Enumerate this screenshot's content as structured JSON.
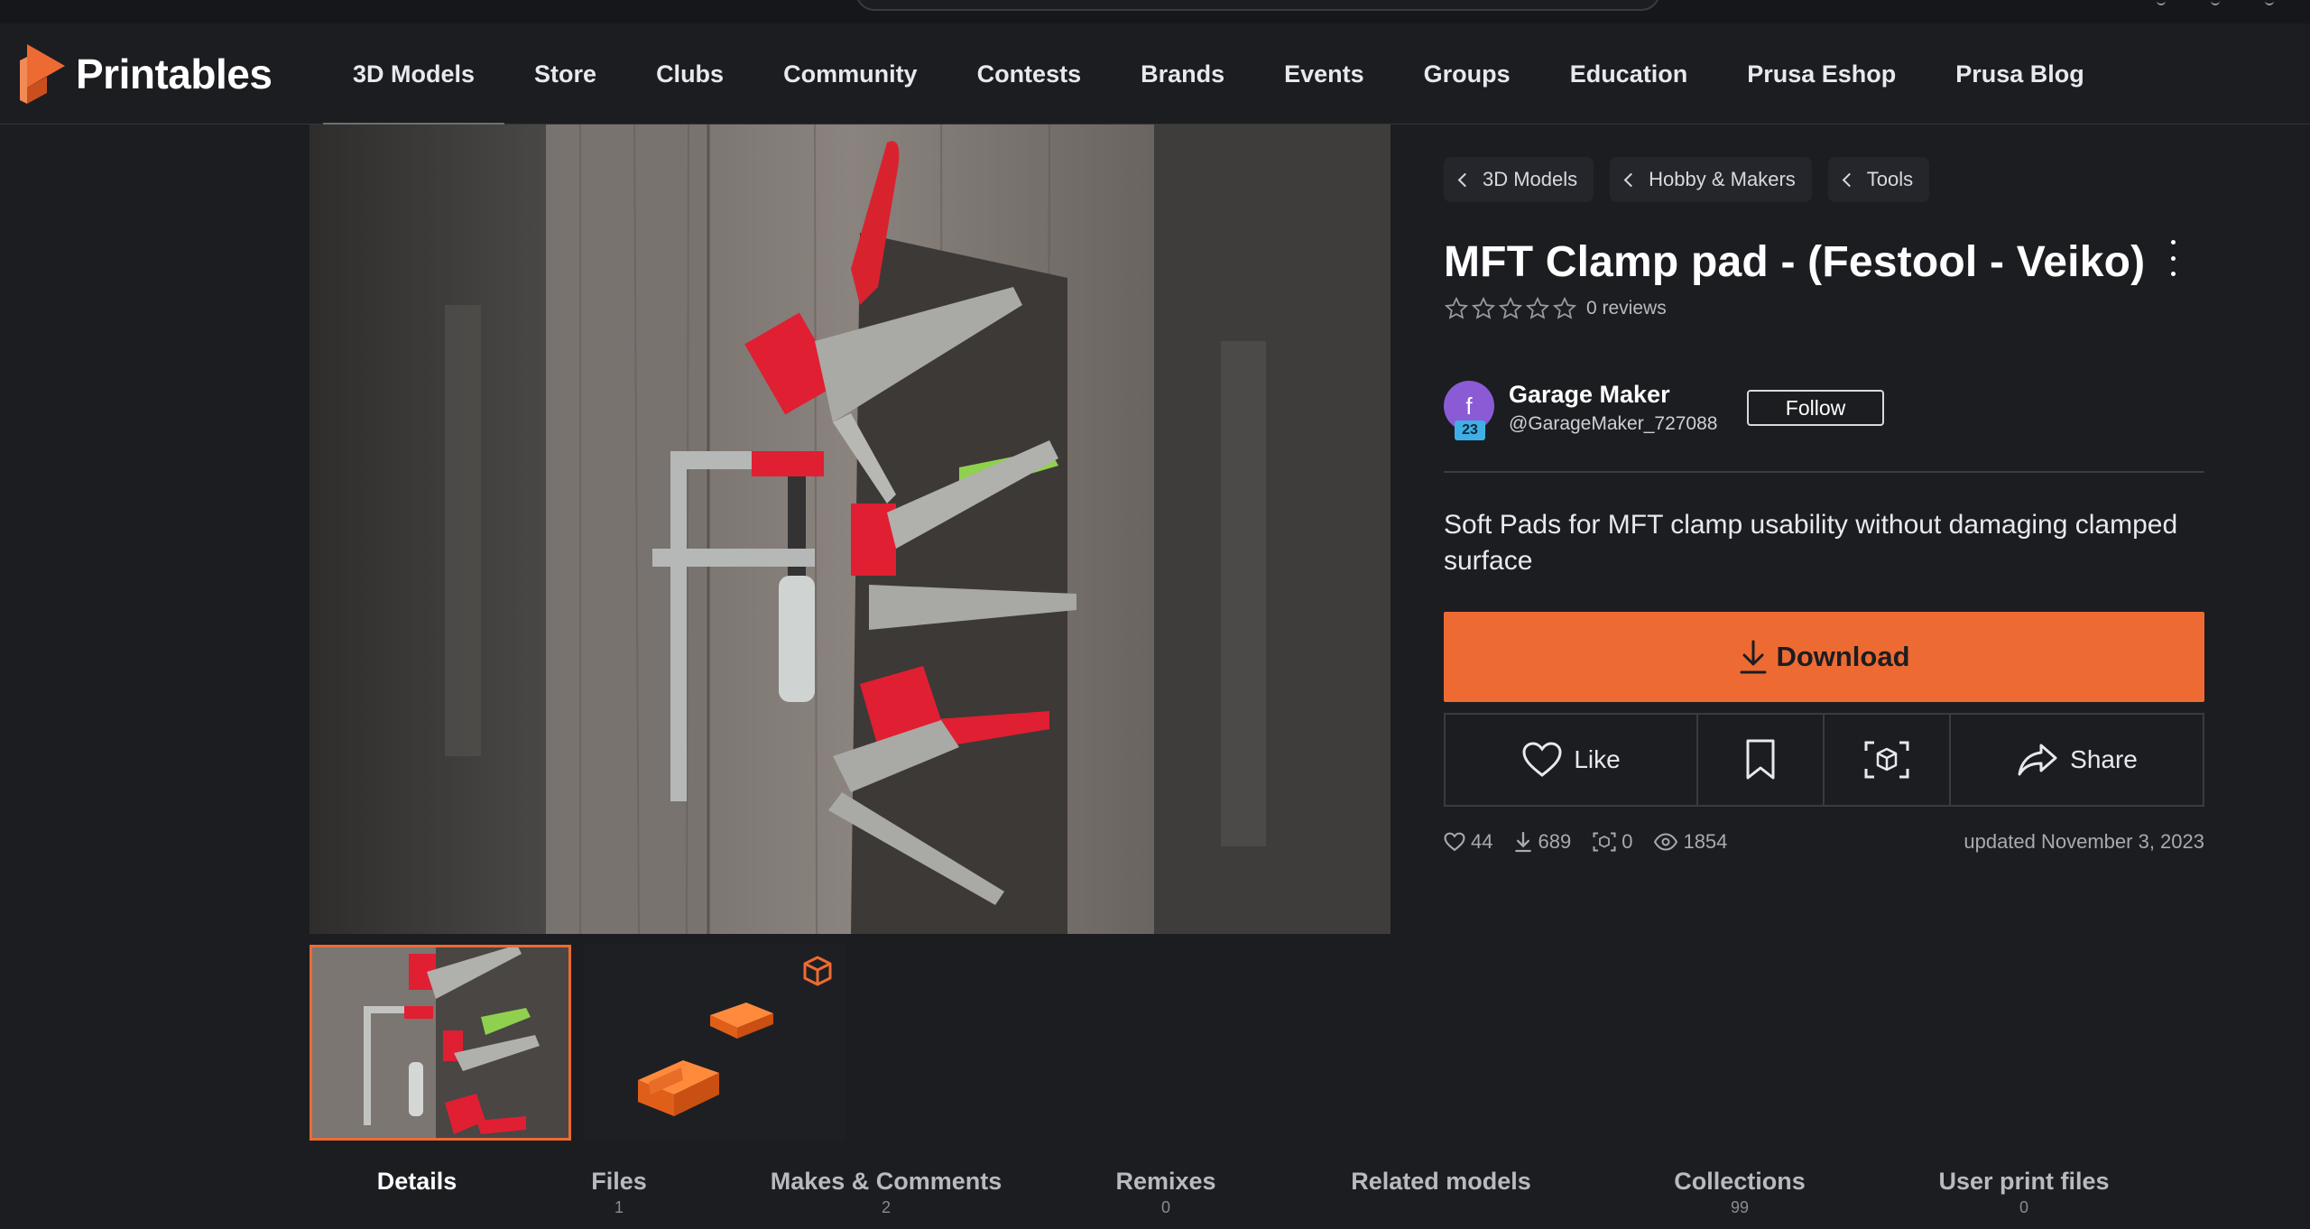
{
  "nav": {
    "brand": "Printables",
    "items": [
      {
        "label": "3D Models",
        "active": true
      },
      {
        "label": "Store"
      },
      {
        "label": "Clubs"
      },
      {
        "label": "Community"
      },
      {
        "label": "Contests"
      },
      {
        "label": "Brands"
      },
      {
        "label": "Events"
      },
      {
        "label": "Groups"
      },
      {
        "label": "Education"
      },
      {
        "label": "Prusa Eshop"
      },
      {
        "label": "Prusa Blog"
      }
    ]
  },
  "gallery": {
    "thumbnails": [
      {
        "type": "photo",
        "active": true
      },
      {
        "type": "3d-model",
        "icon": "cube-icon"
      }
    ]
  },
  "model": {
    "breadcrumbs": [
      "3D Models",
      "Hobby & Makers",
      "Tools"
    ],
    "title": "MFT Clamp pad - (Festool - Veiko)",
    "rating": {
      "stars": 0,
      "max": 5,
      "reviews_label": "0 reviews"
    },
    "author": {
      "avatar_letter": "f",
      "level": "23",
      "name": "Garage Maker",
      "handle": "@GarageMaker_727088",
      "follow_label": "Follow"
    },
    "summary": "Soft Pads for MFT clamp usability without damaging clamped surface",
    "download_label": "Download",
    "actions": {
      "like_label": "Like",
      "share_label": "Share"
    },
    "stats": {
      "likes": "44",
      "downloads": "689",
      "makes": "0",
      "views": "1854",
      "updated": "updated November 3, 2023"
    }
  },
  "tabs": [
    {
      "label": "Details",
      "count": "",
      "active": true
    },
    {
      "label": "Files",
      "count": "1"
    },
    {
      "label": "Makes & Comments",
      "count": "2"
    },
    {
      "label": "Remixes",
      "count": "0"
    },
    {
      "label": "Related models",
      "count": ""
    },
    {
      "label": "Collections",
      "count": "99"
    },
    {
      "label": "User print files",
      "count": "0"
    }
  ],
  "colors": {
    "accent": "#ed6b32",
    "background": "#1c1d21",
    "avatar": "#8b5bd6",
    "badge": "#3fb0e6"
  }
}
